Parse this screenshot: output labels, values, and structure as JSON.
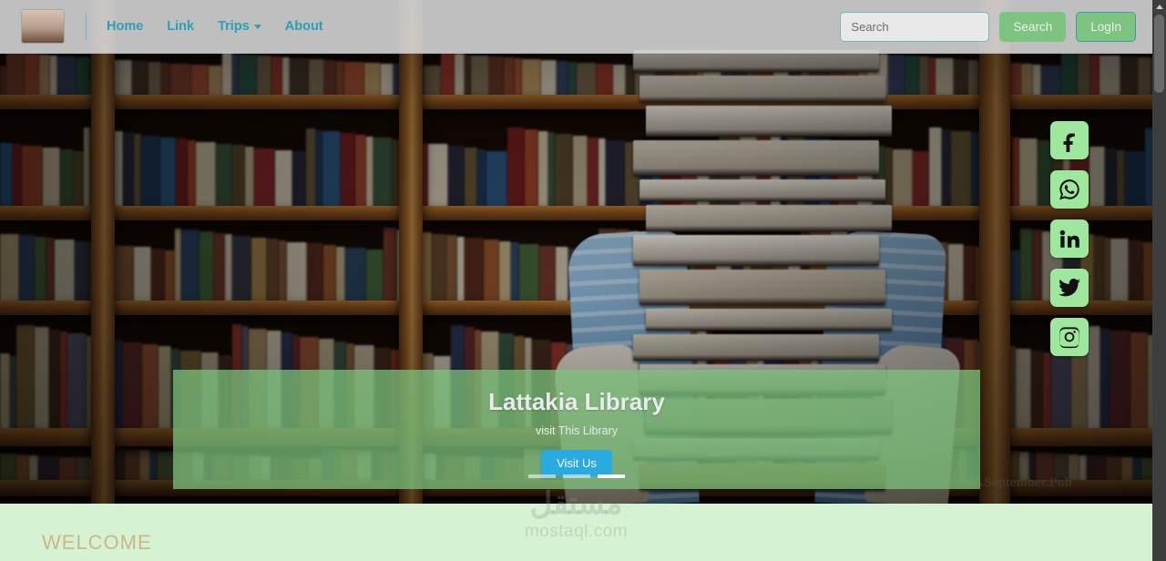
{
  "site": {
    "brand_logo_alt": "stacked-books-logo"
  },
  "navbar": {
    "links": [
      {
        "label": "Home",
        "has_caret": false
      },
      {
        "label": "Link",
        "has_caret": false
      },
      {
        "label": "Trips",
        "has_caret": true
      },
      {
        "label": "About",
        "has_caret": false
      }
    ],
    "search_placeholder": "Search",
    "search_value": "",
    "search_button": "Search",
    "login_button": "LogIn",
    "accent_color": "#2a9fb5",
    "button_color": "#7cc47f"
  },
  "hero": {
    "caption_title": "Lattakia Library",
    "caption_subtitle": "visit This Library",
    "cta_label": "Visit Us",
    "cta_color": "#29abe2",
    "overlay_color": "rgba(126,196,126,0.74)",
    "photo_watermark": "MASeptember.Pub",
    "indicators": [
      {
        "active": false
      },
      {
        "active": false
      },
      {
        "active": true
      }
    ]
  },
  "social": {
    "items": [
      {
        "name": "facebook",
        "title": "Facebook"
      },
      {
        "name": "whatsapp",
        "title": "WhatsApp"
      },
      {
        "name": "linkedin",
        "title": "LinkedIn"
      },
      {
        "name": "twitter",
        "title": "Twitter"
      },
      {
        "name": "instagram",
        "title": "Instagram"
      }
    ],
    "tile_color": "#9ee89e"
  },
  "welcome": {
    "heading": "WELCOME",
    "heading_color": "#cdb787",
    "background_color": "#d5f2d2"
  },
  "watermark": {
    "arabic": "مستقل",
    "latin": "mostaql.com"
  },
  "scrollbar": {
    "up_arrow": "scroll-up"
  }
}
